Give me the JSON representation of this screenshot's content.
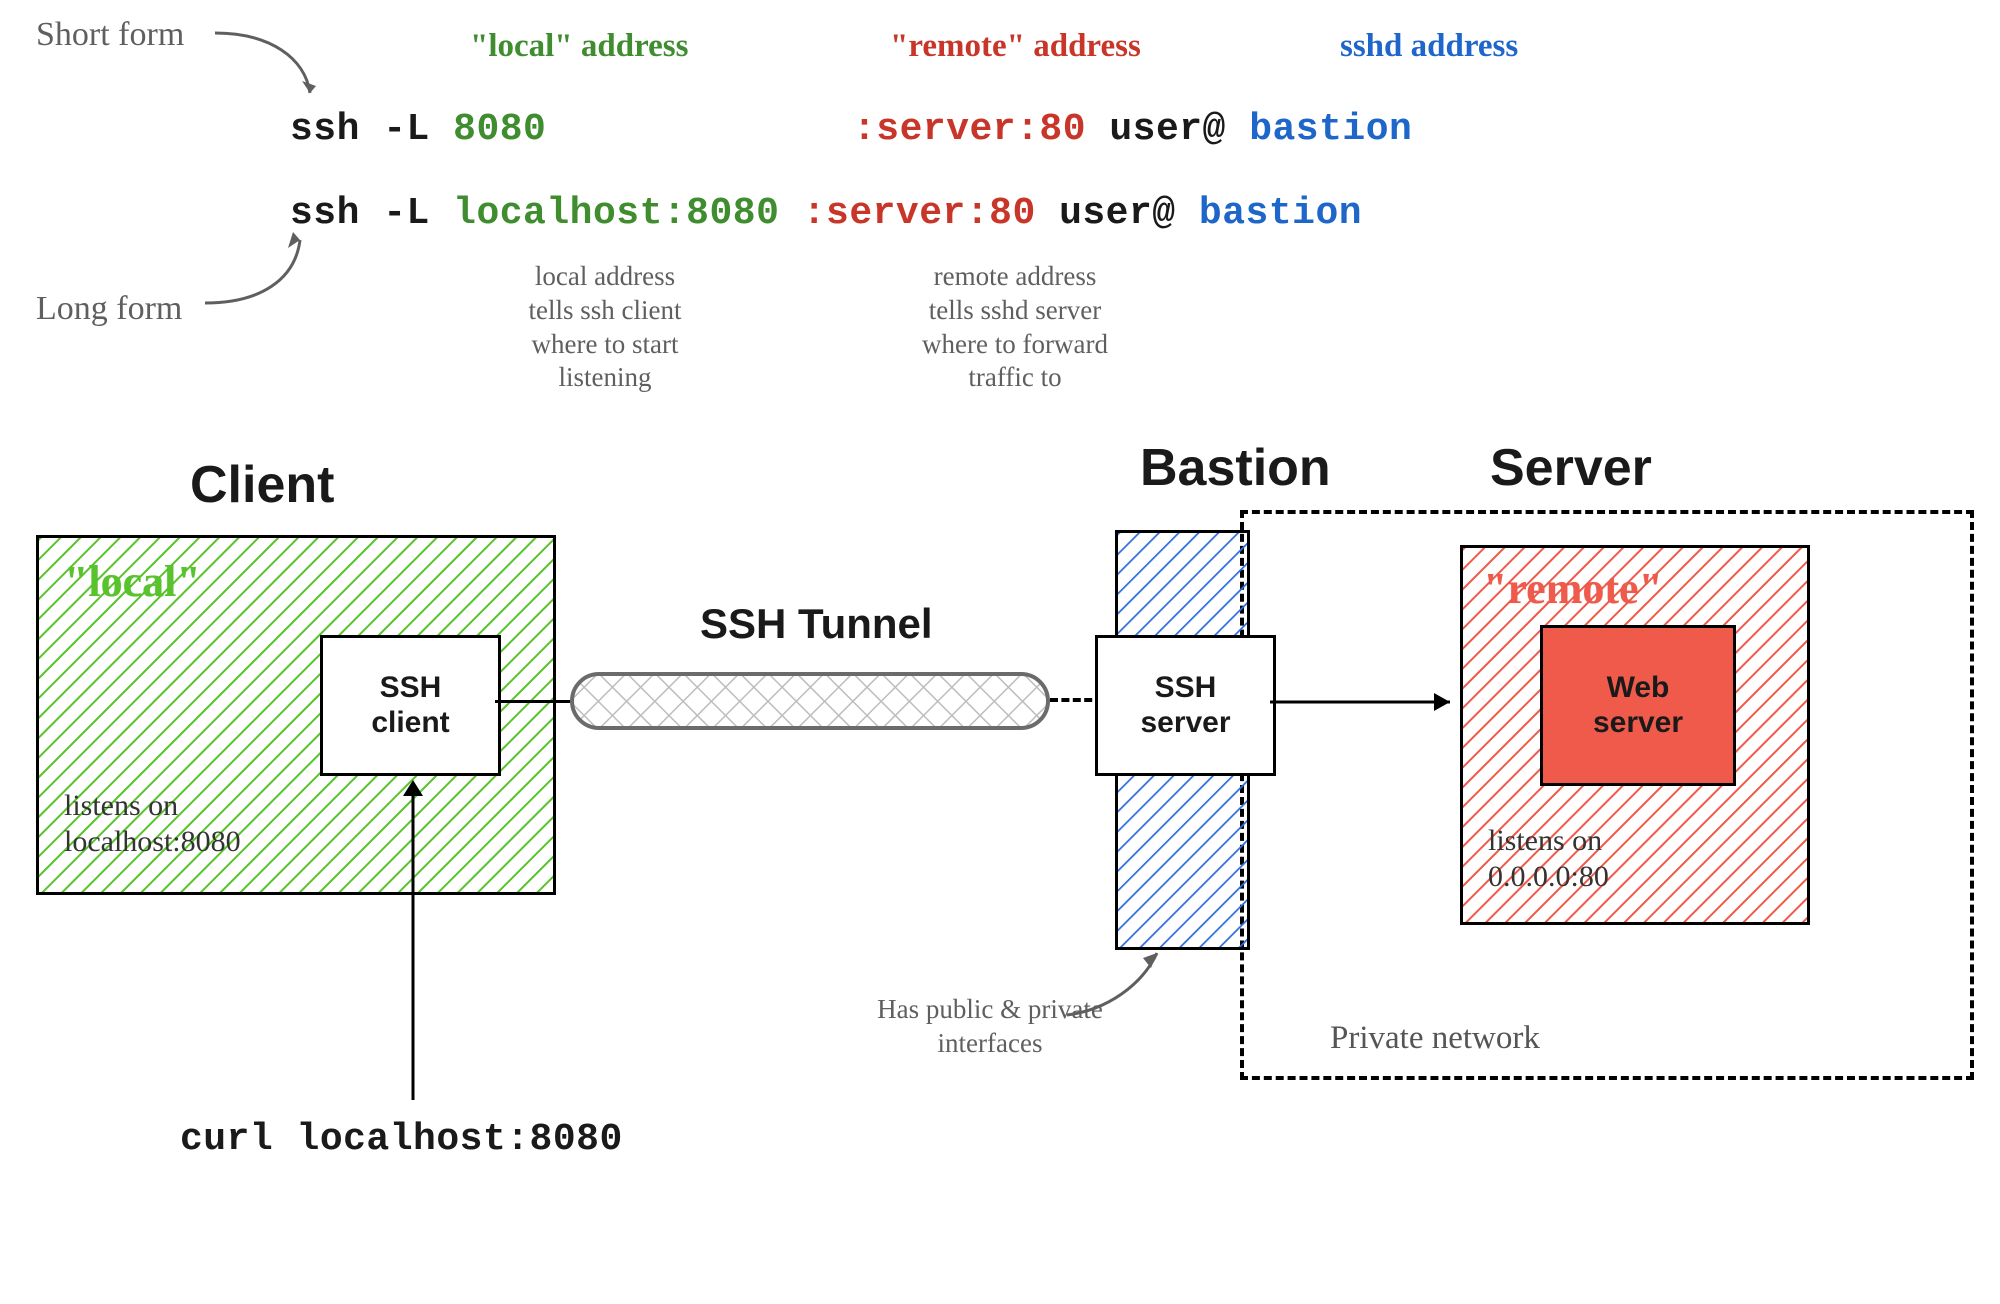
{
  "annotations": {
    "short_form": "Short form",
    "long_form": "Long form",
    "local_addr_lbl": "\"local\" address",
    "remote_addr_lbl": "\"remote\" address",
    "sshd_addr_lbl": "sshd address",
    "local_desc": "local address\ntells ssh client\nwhere to start\nlistening",
    "remote_desc": "remote address\ntells sshd server\nwhere to forward\ntraffic to",
    "bastion_note": "Has public & private\ninterfaces",
    "private_net": "Private network"
  },
  "cmds": {
    "short": {
      "prefix": "ssh -L ",
      "local": "8080",
      "remote": ":server:80",
      "user": " user@",
      "host": "bastion"
    },
    "long": {
      "prefix": "ssh -L ",
      "local": "localhost:8080",
      "remote": ":server:80",
      "user": " user@",
      "host": "bastion"
    }
  },
  "headers": {
    "client": "Client",
    "bastion": "Bastion",
    "server": "Server",
    "tunnel": "SSH Tunnel"
  },
  "boxes": {
    "local_quote": "\"local\"",
    "remote_quote": "\"remote\"",
    "ssh_client": "SSH\nclient",
    "ssh_server": "SSH\nserver",
    "web_server": "Web\nserver",
    "local_listens": "listens on\nlocalhost:8080",
    "remote_listens": "listens on\n0.0.0.0:80"
  },
  "bottom": {
    "curl_cmd": "curl localhost:8080"
  }
}
